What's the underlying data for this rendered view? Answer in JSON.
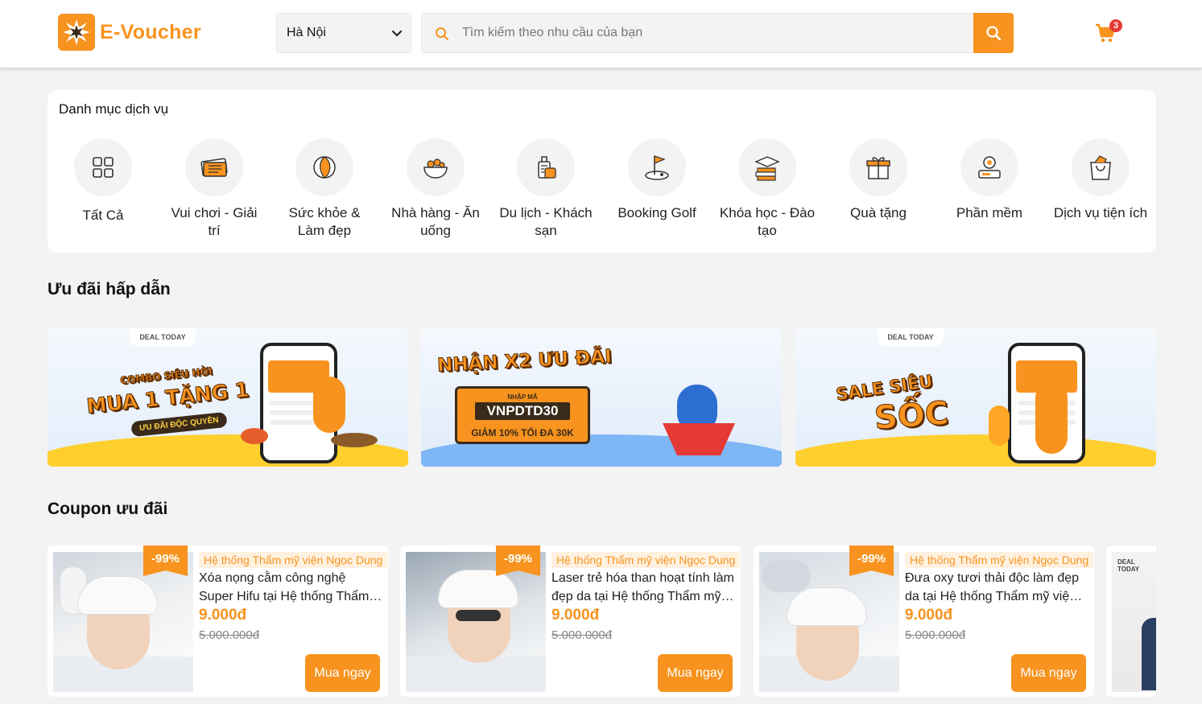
{
  "header": {
    "logo_text": "E-Voucher",
    "city": "Hà Nội",
    "search_placeholder": "Tìm kiếm theo nhu cầu của bạn",
    "cart_count": "3",
    "brand_color": "#f7931e"
  },
  "categories": {
    "title": "Danh mục dịch vụ",
    "items": [
      {
        "label": "Tất Cả",
        "icon": "grid-icon"
      },
      {
        "label": "Vui chơi - Giải trí",
        "icon": "ticket-icon"
      },
      {
        "label": "Sức khỏe & Làm đẹp",
        "icon": "beauty-face-icon"
      },
      {
        "label": "Nhà hàng - Ăn uống",
        "icon": "food-bowl-icon"
      },
      {
        "label": "Du lịch - Khách sạn",
        "icon": "luggage-icon"
      },
      {
        "label": "Booking Golf",
        "icon": "golf-flag-icon"
      },
      {
        "label": "Khóa học - Đào tạo",
        "icon": "graduation-books-icon"
      },
      {
        "label": "Quà tặng",
        "icon": "gift-icon"
      },
      {
        "label": "Phần mềm",
        "icon": "software-user-icon"
      },
      {
        "label": "Dịch vụ tiện ích",
        "icon": "shopping-bag-icon"
      }
    ]
  },
  "deals": {
    "title": "Ưu đãi hấp dẫn",
    "banners": [
      {
        "tag": "DEAL TODAY",
        "line1": "COMBO SIÊU HỜI",
        "line2": "MUA 1 TẶNG 1",
        "pill": "ƯU ĐÃI ĐỘC QUYỀN"
      },
      {
        "line1": "NHẬN X2 ƯU ĐÃI",
        "code_label": "NHẬP MÃ",
        "code": "VNPDTD30",
        "discount": "GIẢM 10% TỐI ĐA 30K"
      },
      {
        "tag": "DEAL TODAY",
        "line1": "SALE SIÊU",
        "line2": "SỐC"
      }
    ]
  },
  "coupons": {
    "title": "Coupon ưu đãi",
    "buy_label": "Mua ngay",
    "items": [
      {
        "discount": "-99%",
        "brand": "Hệ thống Thẩm mỹ viện Ngọc Dung",
        "title": "Xóa nọng cằm công nghệ Super Hifu tại Hệ thống Thẩm mỹ viện Ngọc Dung",
        "price": "9.000đ",
        "old_price": "5.000.000đ"
      },
      {
        "discount": "-99%",
        "brand": "Hệ thống Thẩm mỹ viện Ngọc Dung",
        "title": "Laser trẻ hóa than hoạt tính làm đẹp da tại Hệ thống Thẩm mỹ viện Ngọc Dung",
        "price": "9.000đ",
        "old_price": "5.000.000đ"
      },
      {
        "discount": "-99%",
        "brand": "Hệ thống Thẩm mỹ viện Ngọc Dung",
        "title": "Đưa oxy tươi thải độc làm đẹp da tại Hệ thống Thẩm mỹ viện Ngọc Dung",
        "price": "9.000đ",
        "old_price": "5.000.000đ"
      }
    ],
    "peek_tag": "DEAL TODAY"
  }
}
